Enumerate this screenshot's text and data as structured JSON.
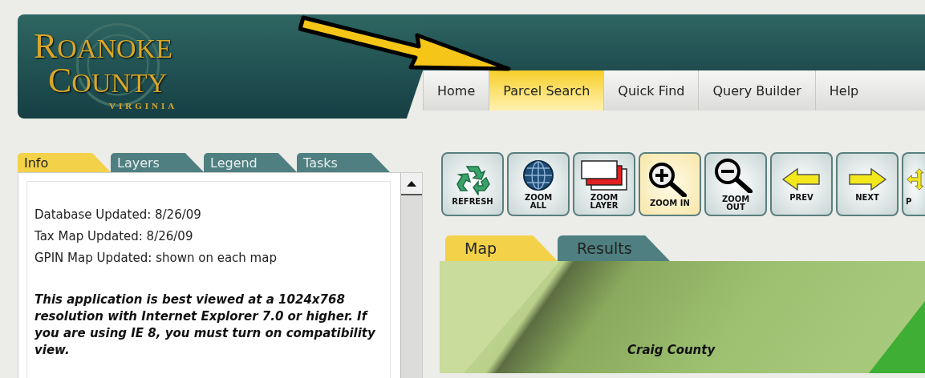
{
  "header": {
    "logo": {
      "lines": [
        "ROANOKE",
        "COUNTY"
      ],
      "subtitle": "VIRGINIA"
    },
    "nav": [
      {
        "label": "Home",
        "selected": false
      },
      {
        "label": "Parcel Search",
        "selected": true
      },
      {
        "label": "Quick Find",
        "selected": false
      },
      {
        "label": "Query Builder",
        "selected": false
      },
      {
        "label": "Help",
        "selected": false
      }
    ]
  },
  "left_panel": {
    "tabs": [
      {
        "label": "Info",
        "selected": true
      },
      {
        "label": "Layers",
        "selected": false
      },
      {
        "label": "Legend",
        "selected": false
      },
      {
        "label": "Tasks",
        "selected": false
      }
    ],
    "info_lines": [
      "Database Updated: 8/26/09",
      "Tax Map Updated: 8/26/09",
      "GPIN Map Updated: shown on each map"
    ],
    "notice": "This application is best viewed at a 1024x768 resolution with Internet Explorer 7.0 or higher. If you are using IE 8, you must turn on compatibility view."
  },
  "toolbar": [
    {
      "label": "REFRESH",
      "kind": "refresh",
      "selected": false
    },
    {
      "label": "ZOOM ALL",
      "kind": "globe",
      "selected": false
    },
    {
      "label": "ZOOM LAYER",
      "kind": "layers",
      "selected": false
    },
    {
      "label": "ZOOM IN",
      "kind": "zoom_in",
      "selected": true
    },
    {
      "label": "ZOOM OUT",
      "kind": "zoom_out",
      "selected": false
    },
    {
      "label": "PREV",
      "kind": "prev",
      "selected": false
    },
    {
      "label": "NEXT",
      "kind": "next",
      "selected": false
    },
    {
      "label": "P",
      "kind": "pan",
      "selected": false
    }
  ],
  "map_tabs": [
    {
      "label": "Map",
      "selected": true
    },
    {
      "label": "Results",
      "selected": false
    }
  ],
  "map": {
    "label": "Craig County"
  }
}
